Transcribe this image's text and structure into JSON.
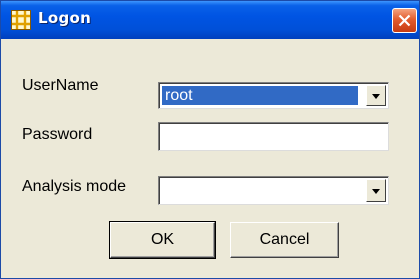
{
  "window": {
    "title": "Logon",
    "icon": "grid-app-icon",
    "close_icon": "close-icon"
  },
  "form": {
    "username": {
      "label": "UserName",
      "value": "root"
    },
    "password": {
      "label": "Password",
      "value": ""
    },
    "analysis_mode": {
      "label": "Analysis mode",
      "value": ""
    }
  },
  "buttons": {
    "ok_label": "OK",
    "cancel_label": "Cancel"
  },
  "colors": {
    "titlebar": "#0054e3",
    "window_face": "#ece9d8",
    "selection": "#316ac5",
    "close_button": "#e35c2e"
  }
}
